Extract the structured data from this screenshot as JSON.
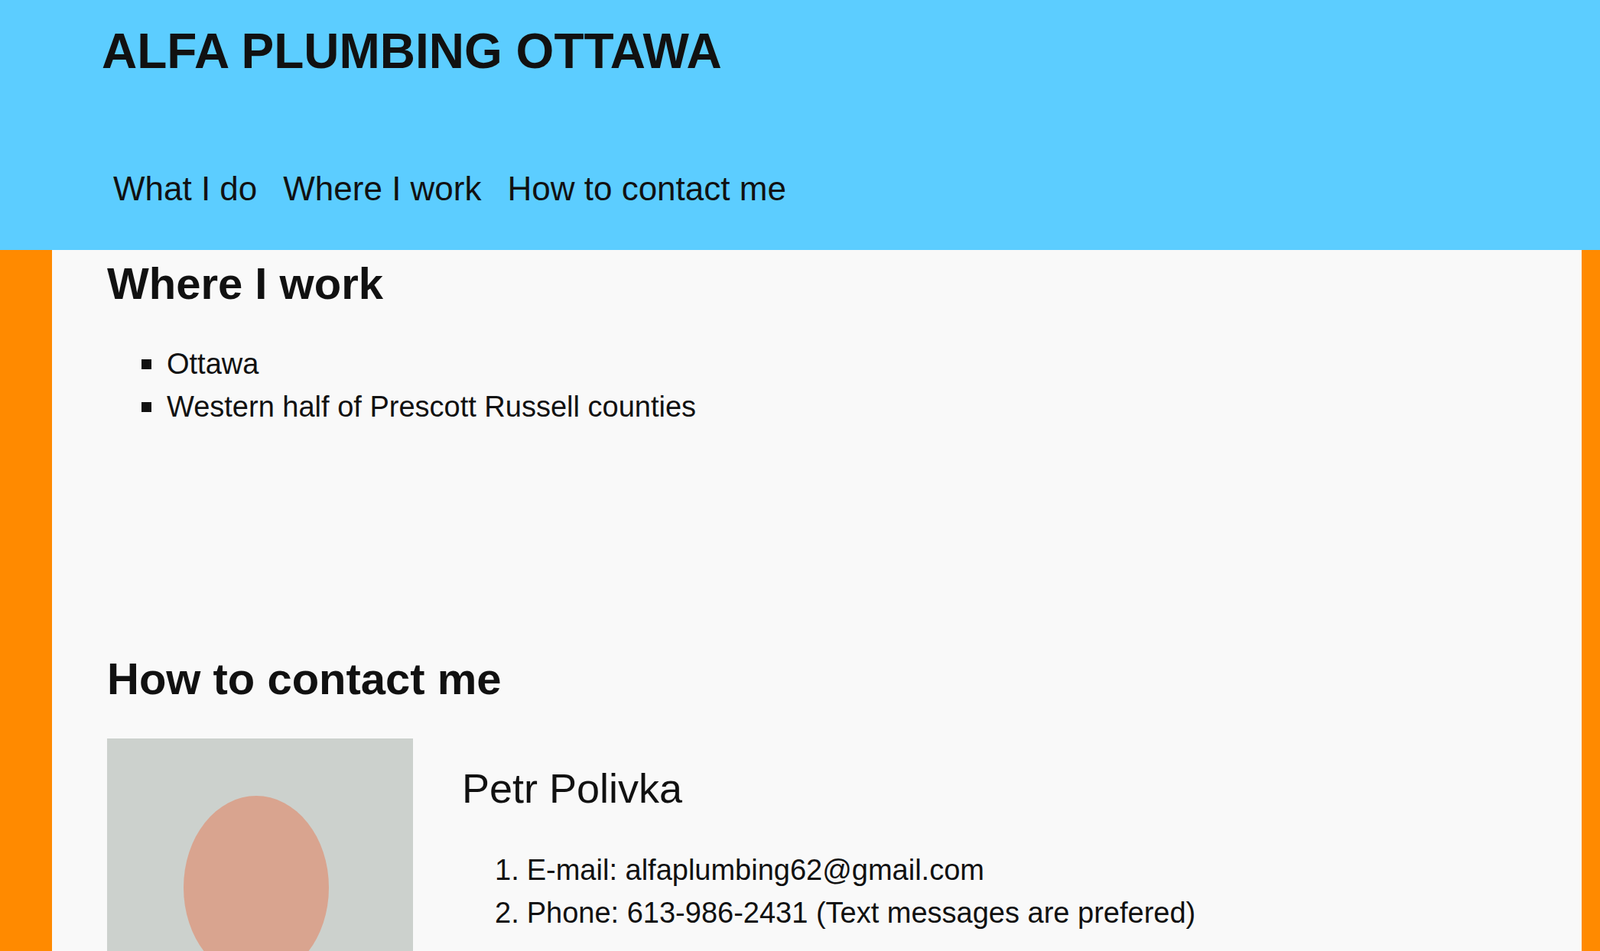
{
  "site_title": "ALFA PLUMBING OTTAWA",
  "nav": [
    {
      "label": "What I do"
    },
    {
      "label": "Where I work"
    },
    {
      "label": "How to contact me"
    }
  ],
  "where": {
    "heading": "Where I work",
    "items": [
      "Ottawa",
      "Western half of Prescott Russell counties"
    ]
  },
  "contact": {
    "heading": "How to contact me",
    "name": "Petr Polivka",
    "items": [
      {
        "number": "1.",
        "text": "E-mail: alfaplumbing62@gmail.com"
      },
      {
        "number": "2.",
        "text": "Phone: 613-986-2431 (Text messages are prefered)"
      }
    ]
  }
}
